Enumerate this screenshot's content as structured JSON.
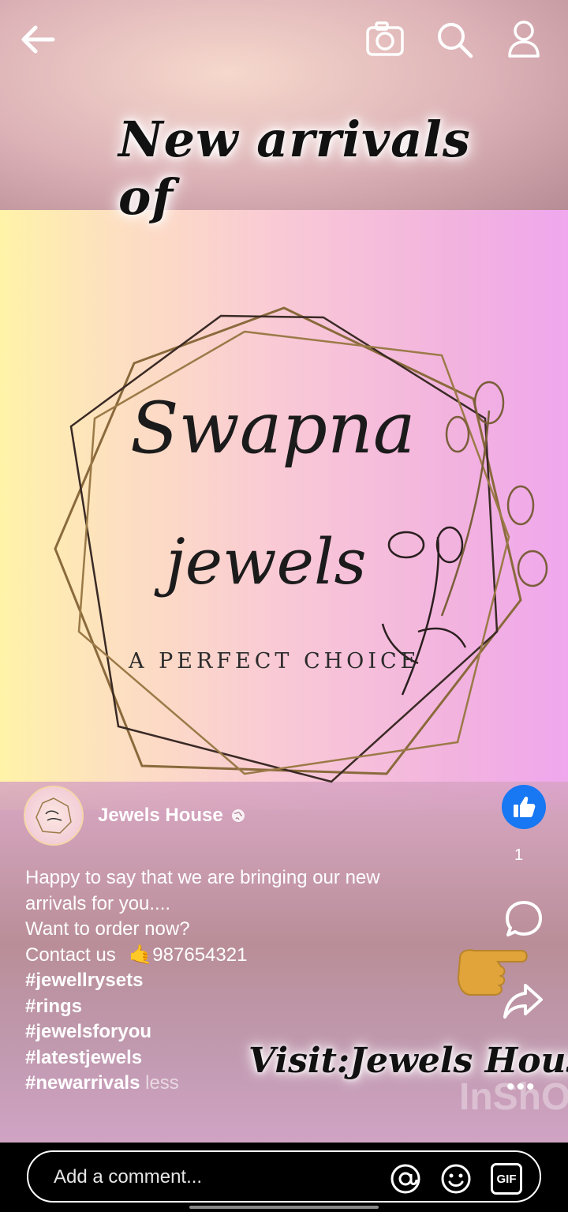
{
  "header": {
    "back_icon": "arrow-left-icon",
    "camera_icon": "camera-icon",
    "search_icon": "search-icon",
    "profile_icon": "person-icon"
  },
  "post_image": {
    "headline": "New arrivals of",
    "logo_line1": "Swapna",
    "logo_line2": "jewels",
    "logo_tagline": "A PERFECT CHOICE",
    "overlay_text": "Visit:Jewels House",
    "watermark": "InShO"
  },
  "author": {
    "name": "Jewels House",
    "privacy_icon": "globe-icon"
  },
  "caption": {
    "line1": "Happy to say that we are bringing our new",
    "line2": "arrivals for you....",
    "line3": "Want to order now?",
    "line4_prefix": "Contact us",
    "line4_emoji": "🤙",
    "line4_phone": "987654321",
    "hashtags": [
      "#jewellrysets",
      "#rings",
      "#jewelsforyou",
      "#latestjewels",
      "#newarrivals"
    ],
    "less_label": "less"
  },
  "actions": {
    "like_icon": "thumbs-up-icon",
    "like_count": "1",
    "comment_icon": "comment-bubble-icon",
    "share_icon": "share-arrow-icon",
    "more_label": "•••"
  },
  "comment_bar": {
    "placeholder": "Add a comment...",
    "mention_icon": "at-sign-icon",
    "emoji_icon": "smiley-icon",
    "gif_label": "GIF"
  },
  "colors": {
    "like_blue": "#1877f2",
    "text_white": "#ffffff"
  }
}
